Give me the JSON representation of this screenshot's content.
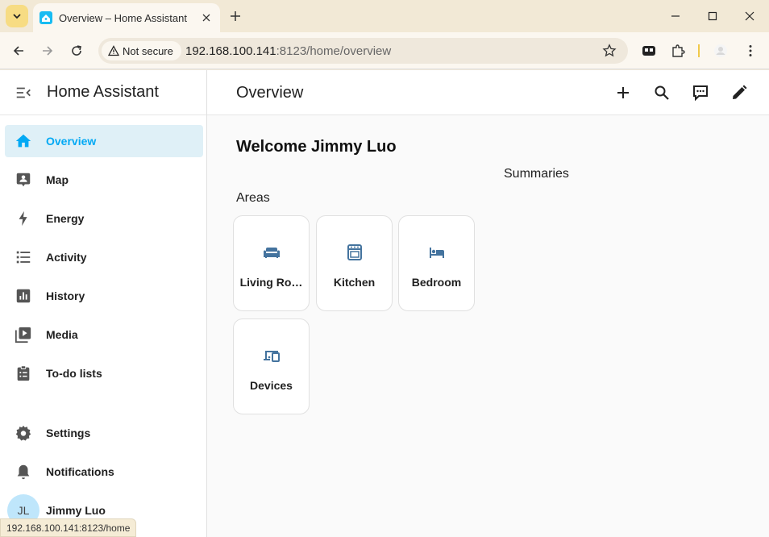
{
  "browser": {
    "tab_title": "Overview – Home Assistant",
    "security_label": "Not secure",
    "url_host": "192.168.100.141",
    "url_rest": ":8123/home/overview",
    "status_url": "192.168.100.141:8123/home"
  },
  "sidebar": {
    "title": "Home Assistant",
    "items": [
      {
        "label": "Overview",
        "icon": "home-icon"
      },
      {
        "label": "Map",
        "icon": "map-account-icon"
      },
      {
        "label": "Energy",
        "icon": "lightning-icon"
      },
      {
        "label": "Activity",
        "icon": "list-icon"
      },
      {
        "label": "History",
        "icon": "chart-box-icon"
      },
      {
        "label": "Media",
        "icon": "play-box-icon"
      },
      {
        "label": "To-do lists",
        "icon": "clipboard-list-icon"
      }
    ],
    "settings_label": "Settings",
    "notifications_label": "Notifications",
    "user_initials": "JL",
    "user_name": "Jimmy Luo"
  },
  "main": {
    "title": "Overview",
    "welcome": "Welcome Jimmy Luo",
    "summaries_heading": "Summaries",
    "areas_heading": "Areas",
    "areas": [
      {
        "label": "Living Ro…",
        "icon": "sofa-icon"
      },
      {
        "label": "Kitchen",
        "icon": "stove-icon"
      },
      {
        "label": "Bedroom",
        "icon": "bed-icon"
      },
      {
        "label": "Devices",
        "icon": "devices-icon"
      }
    ]
  },
  "colors": {
    "accent": "#03a9f4",
    "area_icon": "#44739e",
    "active_bg": "#dff0f7"
  }
}
